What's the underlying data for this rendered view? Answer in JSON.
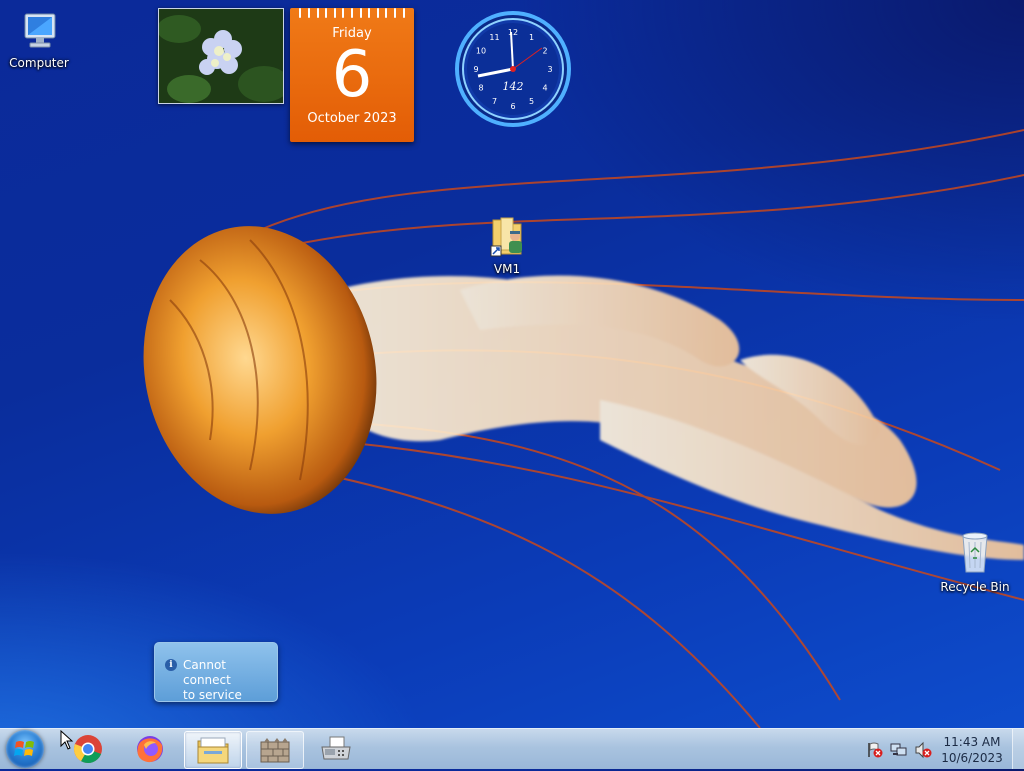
{
  "desktop": {
    "icons": [
      {
        "label": "Computer",
        "icon": "computer-icon"
      },
      {
        "label": "VM1",
        "icon": "folder-shortcut-icon"
      },
      {
        "label": "Recycle Bin",
        "icon": "recycle-bin-icon"
      }
    ]
  },
  "gadgets": {
    "calendar": {
      "weekday": "Friday",
      "day": "6",
      "month_year": "October 2023"
    },
    "clock": {
      "label": "142",
      "numerals": [
        "12",
        "1",
        "2",
        "3",
        "4",
        "5",
        "6",
        "7",
        "8",
        "9",
        "10",
        "11"
      ]
    },
    "slideshow": {
      "icon": "photo-slideshow-icon"
    }
  },
  "notification": {
    "text_line1": "Cannot connect",
    "text_line2": "to service",
    "icon": "info-icon"
  },
  "taskbar": {
    "start": {
      "icon": "windows-start-icon"
    },
    "pinned": [
      {
        "name": "chrome",
        "icon": "chrome-icon"
      },
      {
        "name": "firefox",
        "icon": "firefox-icon"
      },
      {
        "name": "explorer",
        "icon": "file-explorer-icon"
      },
      {
        "name": "firewall",
        "icon": "firewall-icon"
      },
      {
        "name": "fax",
        "icon": "fax-printer-icon"
      }
    ],
    "tray": {
      "icons": [
        "action-center-flag-icon",
        "network-icon",
        "speaker-muted-icon"
      ],
      "time": "11:43 AM",
      "date": "10/6/2023"
    }
  },
  "colors": {
    "accent": "#e9670b",
    "desktop": "#0b2f9f"
  }
}
